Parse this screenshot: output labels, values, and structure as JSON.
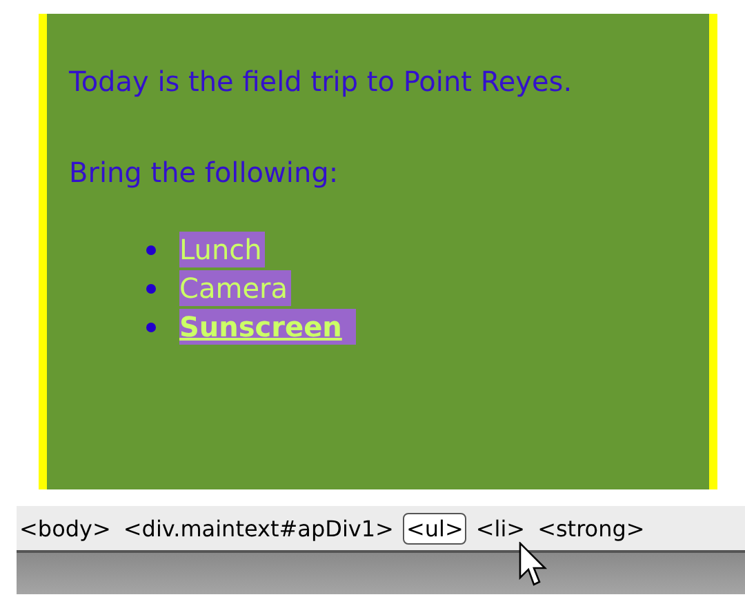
{
  "document": {
    "paragraphs": [
      "Today is the field trip to Point Reyes.",
      "Bring the following:"
    ],
    "list_items": [
      {
        "text": "Lunch",
        "bold": false,
        "selected": true
      },
      {
        "text": "Camera",
        "bold": false,
        "selected": true
      },
      {
        "text": "Sunscreen",
        "bold": true,
        "selected": true
      }
    ]
  },
  "tag_selector": [
    {
      "label": "<body>",
      "selected": false
    },
    {
      "label": "<div.maintext#apDiv1>",
      "selected": false
    },
    {
      "label": "<ul>",
      "selected": true
    },
    {
      "label": "<li>",
      "selected": false
    },
    {
      "label": "<strong>",
      "selected": false
    }
  ]
}
